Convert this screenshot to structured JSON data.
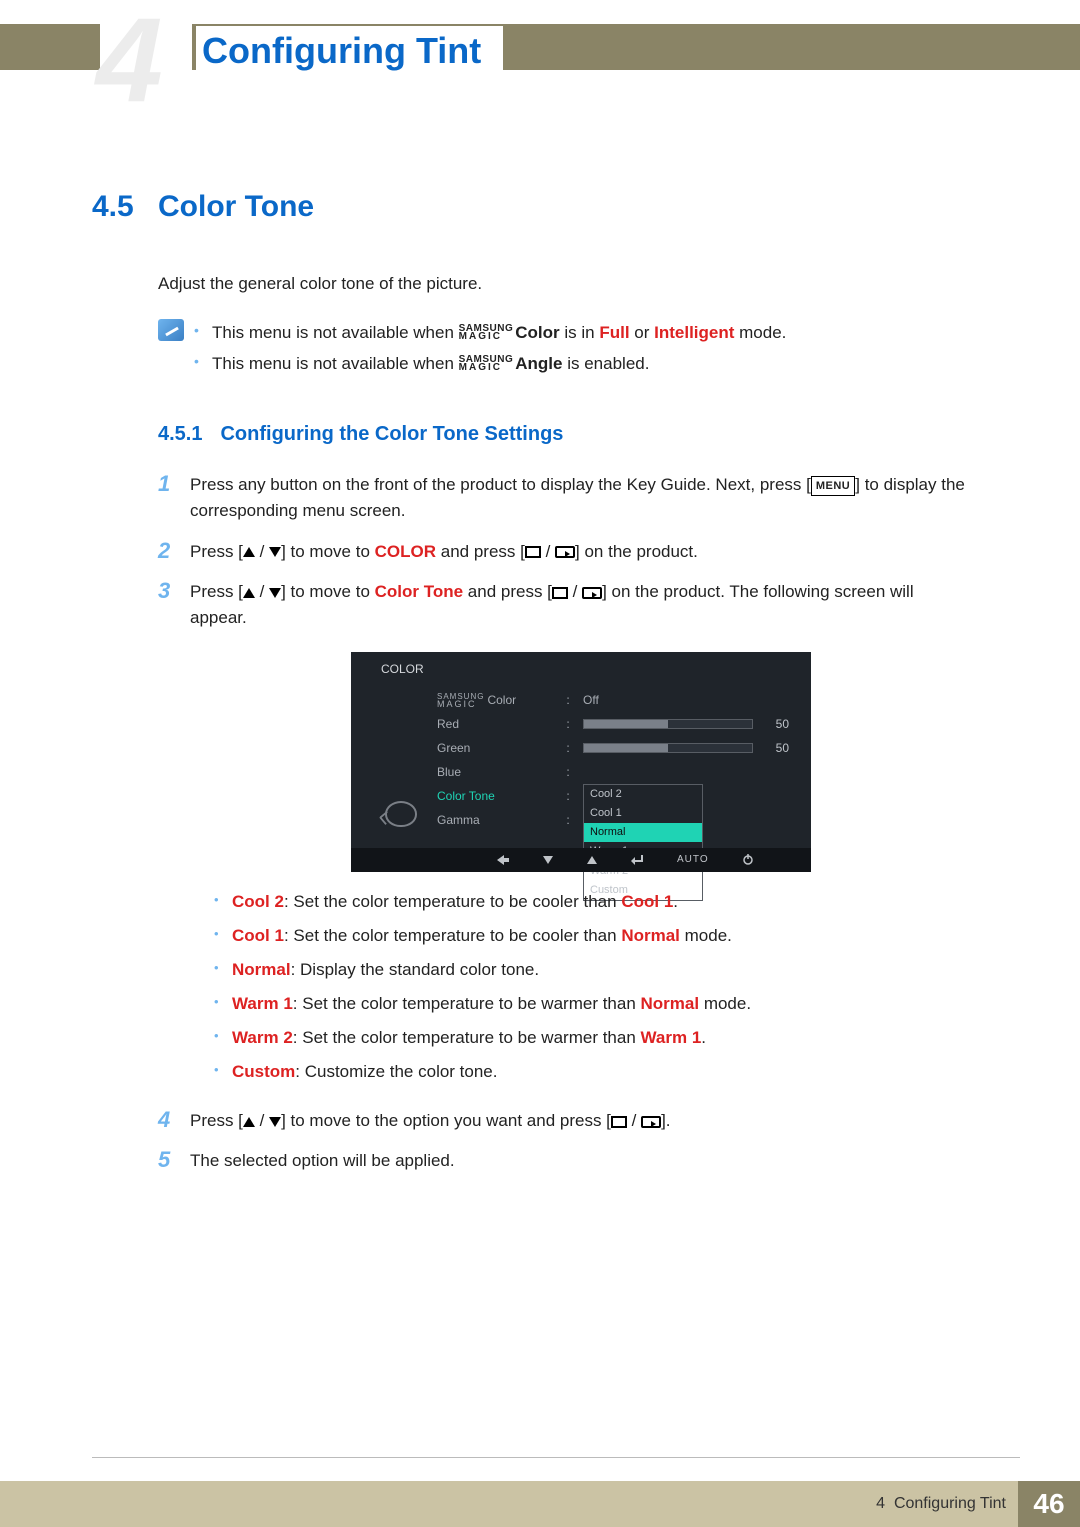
{
  "header": {
    "chapter_number": "4",
    "page_title": "Configuring Tint"
  },
  "section": {
    "number": "4.5",
    "title": "Color Tone",
    "intro": "Adjust the general color tone of the picture.",
    "notes": {
      "magic_top": "SAMSUNG",
      "magic_bot": "MAGIC",
      "line1_pre": "This menu is not available when ",
      "line1_color": "Color",
      "line1_mid": " is in ",
      "line1_full": "Full",
      "line1_or": " or ",
      "line1_intel": "Intelligent",
      "line1_post": " mode.",
      "line2_pre": "This menu is not available when ",
      "line2_angle": "Angle",
      "line2_post": " is enabled."
    }
  },
  "subsection": {
    "number": "4.5.1",
    "title": "Configuring the Color Tone Settings"
  },
  "steps": {
    "s1_a": "Press any button on the front of the product to display the Key Guide. Next, press [",
    "s1_menu": "MENU",
    "s1_b": "] to display the corresponding menu screen.",
    "s2_a": "Press [",
    "s2_b": "] to move to ",
    "s2_color": "COLOR",
    "s2_c": " and press [",
    "s2_d": "] on the product.",
    "s3_a": "Press [",
    "s3_b": "] to move to ",
    "s3_ct": "Color Tone",
    "s3_c": " and press [",
    "s3_d": "] on the product. The following screen will appear.",
    "s4_a": "Press [",
    "s4_b": "] to move to the option you want and press [",
    "s4_c": "].",
    "s5": "The selected option will be applied."
  },
  "osd": {
    "title": "COLOR",
    "magic_top": "SAMSUNG",
    "magic_bot": "MAGIC",
    "items": {
      "magic_color": "Color",
      "red": "Red",
      "green": "Green",
      "blue": "Blue",
      "color_tone": "Color Tone",
      "gamma": "Gamma"
    },
    "values": {
      "magic_color": "Off",
      "red": "50",
      "green": "50"
    },
    "tone_options": [
      "Cool 2",
      "Cool 1",
      "Normal",
      "Warm 1",
      "Warm 2",
      "Custom"
    ],
    "nav_auto": "AUTO"
  },
  "bullets": {
    "cool2_k": "Cool 2",
    "cool2_t": ": Set the color temperature to be cooler than ",
    "cool2_r": "Cool 1",
    "cool2_end": ".",
    "cool1_k": "Cool 1",
    "cool1_t": ": Set the color temperature to be cooler than ",
    "cool1_r": "Normal",
    "cool1_end": " mode.",
    "normal_k": "Normal",
    "normal_t": ": Display the standard color tone.",
    "warm1_k": "Warm 1",
    "warm1_t": ": Set the color temperature to be warmer than ",
    "warm1_r": "Normal",
    "warm1_end": " mode.",
    "warm2_k": "Warm 2",
    "warm2_t": ": Set the color temperature to be warmer than ",
    "warm2_r": "Warm 1",
    "warm2_end": ".",
    "custom_k": "Custom",
    "custom_t": ": Customize the color tone."
  },
  "footer": {
    "crumb_num": "4",
    "crumb_text": "Configuring Tint",
    "page_number": "46"
  }
}
